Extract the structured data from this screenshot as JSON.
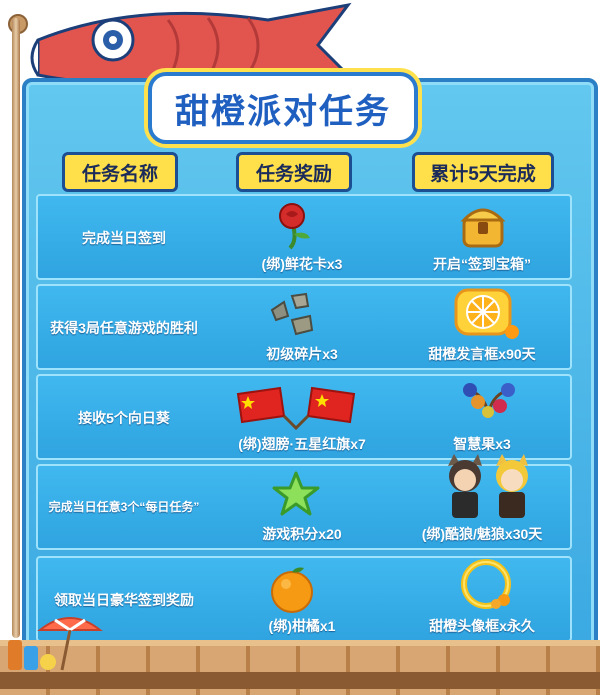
{
  "title": "甜橙派对任务",
  "headers": {
    "task": "任务名称",
    "reward": "任务奖励",
    "cumulative": "累计5天完成"
  },
  "rows": [
    {
      "task": "完成当日签到",
      "reward": "(绑)鲜花卡x3",
      "cumulative": "开启“签到宝箱”"
    },
    {
      "task": "获得3局任意游戏的胜利",
      "reward": "初级碎片x3",
      "cumulative": "甜橙发言框x90天"
    },
    {
      "task": "接收5个向日葵",
      "reward": "(绑)翅膀·五星红旗x7",
      "cumulative": "智慧果x3"
    },
    {
      "task": "完成当日任意3个“每日任务”",
      "reward": "游戏积分x20",
      "cumulative": "(绑)酷狼/魅狼x30天"
    },
    {
      "task": "领取当日豪华签到奖励",
      "reward": "(绑)柑橘x1",
      "cumulative": "甜橙头像框x永久"
    }
  ],
  "icons": {
    "row1": [
      "rose-icon",
      "treasure-chest-icon"
    ],
    "row2": [
      "stone-fragments-icon",
      "orange-chat-frame-icon"
    ],
    "row3": [
      "china-flag-wings-icon",
      "wisdom-fruit-icon"
    ],
    "row4": [
      "green-star-icon",
      "wolf-avatars-icon"
    ],
    "row5": [
      "tangerine-icon",
      "orange-avatar-frame-icon"
    ]
  },
  "colors": {
    "panel": "#3aa8e2",
    "header": "#ffe04a",
    "title": "#1f5fc0",
    "border": "#2b7fc4"
  }
}
